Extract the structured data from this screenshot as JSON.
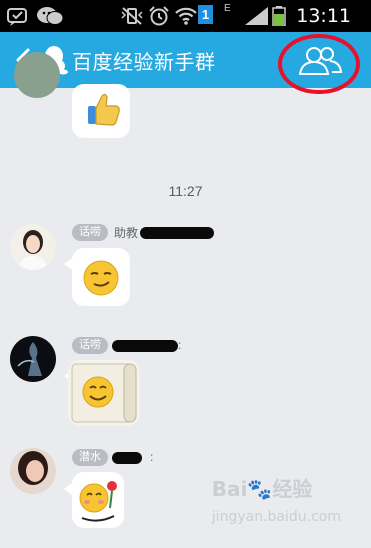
{
  "status_bar": {
    "time": "13:11",
    "network_type": "E",
    "notification_count": "1",
    "icons": [
      "message-icon",
      "wechat-icon",
      "vibrate-mute-icon",
      "alarm-icon",
      "wifi-icon",
      "sim-badge-icon",
      "signal-icon",
      "battery-icon"
    ]
  },
  "header": {
    "title": "百度经验新手群",
    "back_icon": "chevron-left-icon",
    "group_icon": "qq-penguin-icon",
    "members_icon": "group-members-icon",
    "highlight_color": "#e8112d"
  },
  "chat": {
    "time_divider": "11:27",
    "messages": [
      {
        "sender_tag": "",
        "sender_name": "",
        "content": "thumbs-up-sticker"
      },
      {
        "sender_tag": "话唠",
        "sender_name": "助教",
        "name_suffix": "",
        "content": "smirk-emoji-sticker"
      },
      {
        "sender_tag": "话唠",
        "sender_name": "",
        "name_suffix": ":",
        "content": "scroll-smile-sticker"
      },
      {
        "sender_tag": "潜水",
        "sender_name": "",
        "name_suffix": ":",
        "content": "flower-emoji-sticker"
      }
    ]
  },
  "watermark": {
    "brand": "Bai",
    "paw": "du",
    "label": "经验",
    "url": "jingyan.baidu.com"
  },
  "colors": {
    "accent": "#26a9e0",
    "background": "#e9ebee",
    "tag_bg": "#b9bdc3"
  }
}
